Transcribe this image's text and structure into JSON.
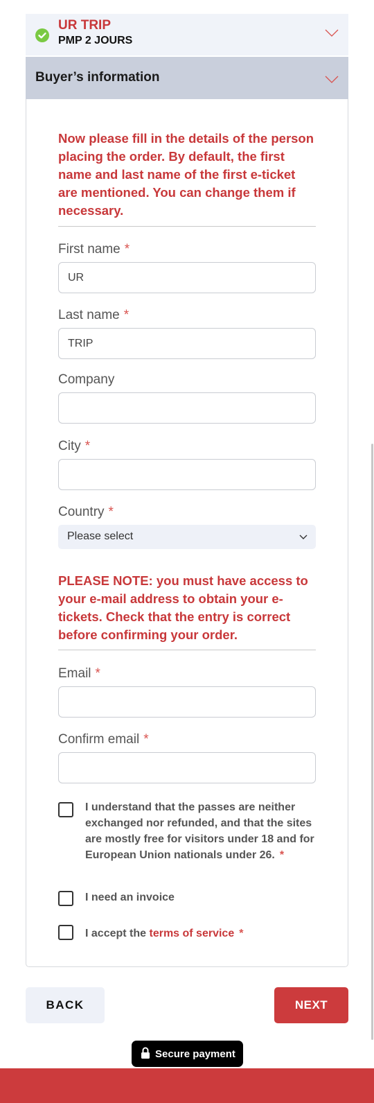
{
  "trip": {
    "title": "UR TRIP",
    "subtitle": "PMP 2 JOURS"
  },
  "buyer_section": {
    "title": "Buyer’s information"
  },
  "intro_notice": "Now please fill in the details of the person placing the order. By default, the first name and last name of the first e-ticket are mentioned. You can change them if necessary.",
  "form": {
    "first_name": {
      "label": "First name",
      "value": "UR",
      "required": "*"
    },
    "last_name": {
      "label": "Last name",
      "value": "TRIP",
      "required": "*"
    },
    "company": {
      "label": "Company",
      "value": ""
    },
    "city": {
      "label": "City",
      "value": "",
      "required": "*"
    },
    "country": {
      "label": "Country",
      "selected": "Please select",
      "required": "*"
    },
    "email_notice": "PLEASE NOTE: you must have access to your e-mail address to obtain your e-tickets. Check that the entry is correct before confirming your order.",
    "email": {
      "label": "Email",
      "value": "",
      "required": "*"
    },
    "confirm_email": {
      "label": "Confirm email",
      "value": "",
      "required": "*"
    }
  },
  "checkboxes": {
    "policy": {
      "text": "I understand that the passes are neither exchanged nor refunded, and that the sites are mostly free for visitors under 18 and for European Union nationals under 26.",
      "required": "*",
      "checked": false
    },
    "invoice": {
      "text": "I need an invoice",
      "checked": false
    },
    "terms": {
      "prefix": "I accept the",
      "link": "terms of service",
      "required": "*",
      "checked": false
    }
  },
  "buttons": {
    "back": "BACK",
    "next": "NEXT"
  },
  "secure_badge": "Secure payment",
  "colors": {
    "accent": "#cc3b3d",
    "success": "#7ac943",
    "header_bg": "#c9cfdc",
    "light_bg": "#eef1f8"
  },
  "icons": [
    "check-circle-icon",
    "chevron-down-icon",
    "lock-icon"
  ]
}
